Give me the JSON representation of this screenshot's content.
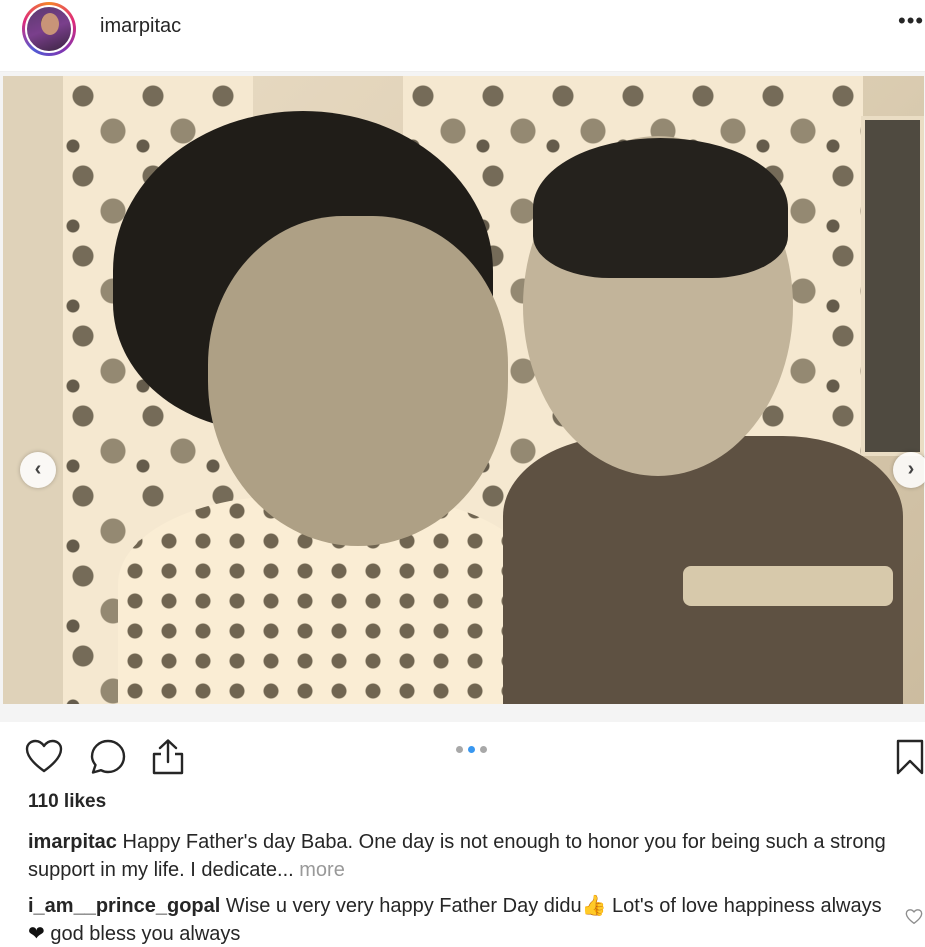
{
  "header": {
    "username": "imarpitac",
    "more_icon": "•••"
  },
  "carousel": {
    "prev": "‹",
    "next": "›",
    "slide_count": 3,
    "active_slide": 2
  },
  "actions": {
    "like_icon": "heart-icon",
    "comment_icon": "comment-icon",
    "share_icon": "share-icon",
    "save_icon": "bookmark-icon",
    "accent_color": "#3897f0"
  },
  "likes": "110 likes",
  "caption": {
    "username": "imarpitac",
    "text": "Happy Father's day Baba. One day is not enough to honor you for being such a strong support in my life. I dedicate...",
    "more": "more"
  },
  "comment": {
    "username": "i_am__prince_gopal",
    "text_part1": "Wise u very very happy Father Day didu",
    "emoji1": "👍",
    "text_part2": " Lot's of love happiness always",
    "emoji2": "❤",
    "text_part3": " god bless you always"
  }
}
